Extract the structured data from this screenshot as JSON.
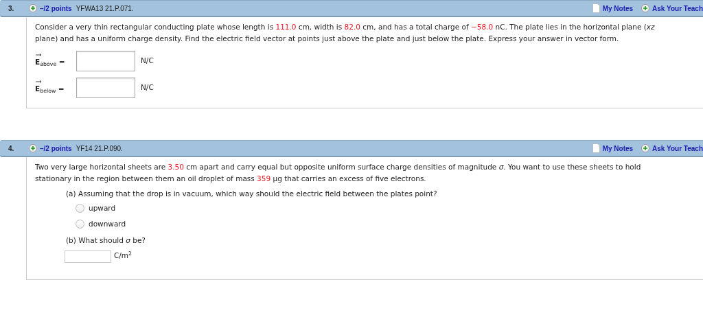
{
  "questions": [
    {
      "number": "3.",
      "points": "–/2 points",
      "code": "YFWA13 21.P.071.",
      "links": [
        {
          "kind": "notes",
          "label": "My Notes"
        },
        {
          "kind": "ask",
          "label": "Ask Your Teach"
        }
      ],
      "paragraphs": [
        [
          {
            "text": "Consider a very thin rectangular conducting plate whose length is ",
            "highlight": false
          },
          {
            "text": "111.0",
            "highlight": true
          },
          {
            "text": " cm, width is ",
            "highlight": false
          },
          {
            "text": "82.0",
            "highlight": true
          },
          {
            "text": " cm, and has a total charge of  ",
            "highlight": false
          },
          {
            "text": "−58.0",
            "highlight": true
          },
          {
            "text": " nC.  The plate lies in the horizontal plane (*xz* plane) and has a uniform charge density. Find the electric field vector at points just above the plate and just below the plate. Express your answer in vector form.",
            "highlight": false
          }
        ]
      ],
      "items": [
        {
          "kind": "vector",
          "label": "**E**$_{above}$ =",
          "unit": "N/C"
        },
        {
          "kind": "vector",
          "label": "**E**$_{below}$ =",
          "unit": "N/C"
        }
      ]
    },
    {
      "number": "4.",
      "points": "–/2 points",
      "code": "YF14 21.P.090.",
      "links": [
        {
          "kind": "notes",
          "label": "My Notes"
        },
        {
          "kind": "ask",
          "label": "Ask Your Teach"
        }
      ],
      "paragraphs": [
        [
          {
            "text": "Two very large horizontal sheets are ",
            "highlight": false
          },
          {
            "text": "3.50",
            "highlight": true
          },
          {
            "text": " cm apart and carry equal but opposite uniform surface charge densities of magnitude *σ*. You want to use these sheets to hold stationary in the region between them an oil droplet of mass ",
            "highlight": false
          },
          {
            "text": "359",
            "highlight": true
          },
          {
            "text": " µg that carries an excess of five electrons.",
            "highlight": false
          }
        ]
      ],
      "items": [
        {
          "kind": "prompt",
          "text": "(a) Assuming that the drop is in vacuum, which way should the electric field between the plates point?"
        },
        {
          "kind": "radio",
          "options": [
            {
              "label": "upward",
              "selected": false
            },
            {
              "label": "downward",
              "selected": false
            }
          ]
        },
        {
          "kind": "prompt",
          "text": "(b) What should *σ* be?"
        },
        {
          "kind": "field",
          "unit": "C/m$^{2}$"
        }
      ]
    }
  ]
}
